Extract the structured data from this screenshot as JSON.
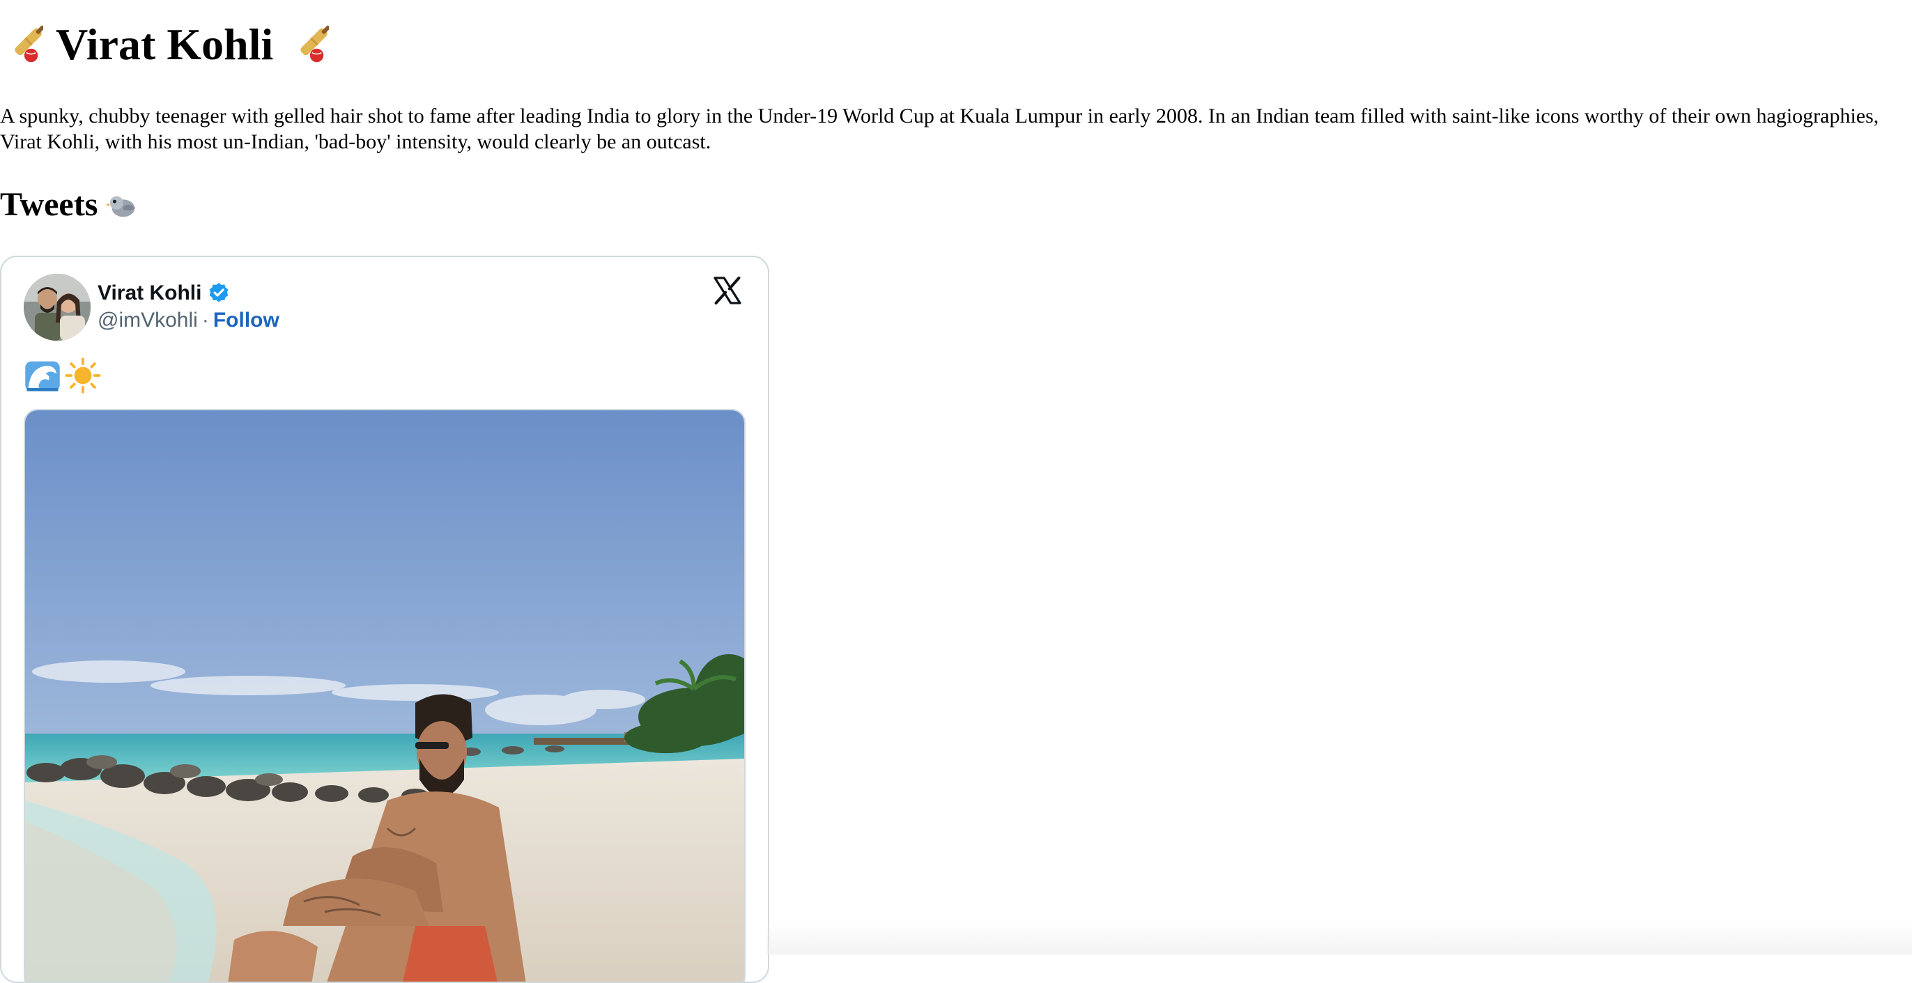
{
  "page": {
    "title": "Virat Kohli",
    "intro": "A spunky, chubby teenager with gelled hair shot to fame after leading India to glory in the Under-19 World Cup at Kuala Lumpur in early 2008. In an Indian team filled with saint-like icons worthy of their own hagiographies, Virat Kohli, with his most un-Indian, 'bad-boy' intensity, would clearly be an outcast.",
    "tweets_heading": "Tweets",
    "title_icons": [
      "cricket-bat-and-ball-icon",
      "cricket-bat-and-ball-icon"
    ],
    "tweets_heading_icon": "bird-icon"
  },
  "tweet": {
    "author_name": "Virat Kohli",
    "verified": true,
    "handle": "@imVkohli",
    "separator": "·",
    "follow_label": "Follow",
    "platform_icon": "x-logo-icon",
    "text_emojis": [
      "water-wave-icon",
      "sun-icon"
    ],
    "media_description_icon": "photo",
    "colors": {
      "follow_link": "#1d65bf",
      "verified_badge": "#1d9bf0",
      "border": "#cfd9de",
      "handle": "#536471"
    }
  }
}
